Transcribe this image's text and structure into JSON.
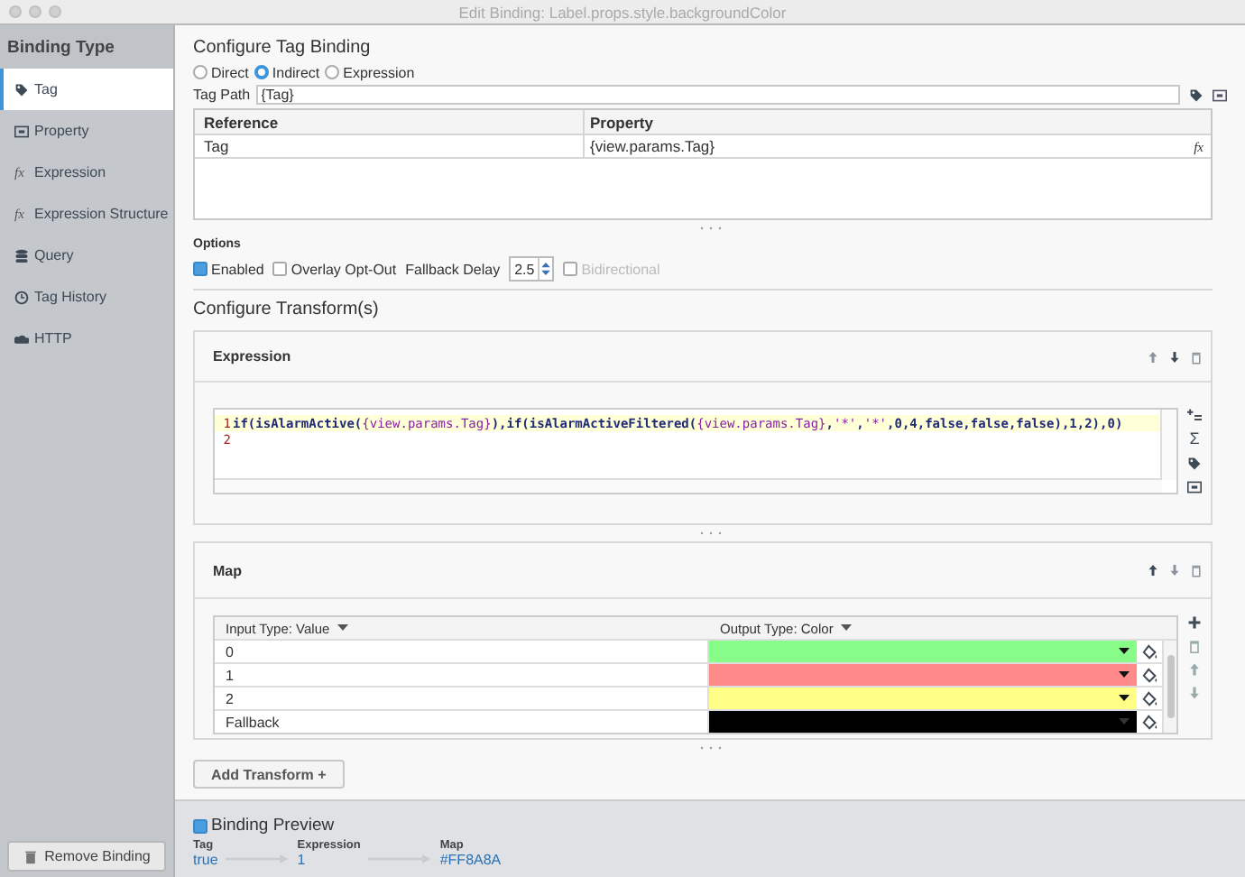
{
  "window": {
    "title": "Edit Binding: Label.props.style.backgroundColor"
  },
  "sidebar": {
    "title": "Binding Type",
    "items": [
      {
        "label": "Tag",
        "selected": true
      },
      {
        "label": "Property",
        "selected": false
      },
      {
        "label": "Expression",
        "selected": false,
        "glyph": "fx"
      },
      {
        "label": "Expression Structure",
        "selected": false,
        "glyph": "fx"
      },
      {
        "label": "Query",
        "selected": false
      },
      {
        "label": "Tag History",
        "selected": false
      },
      {
        "label": "HTTP",
        "selected": false
      }
    ],
    "remove_button": "Remove Binding"
  },
  "tag_binding": {
    "title": "Configure Tag Binding",
    "modes": [
      {
        "label": "Direct",
        "selected": false
      },
      {
        "label": "Indirect",
        "selected": true
      },
      {
        "label": "Expression",
        "selected": false
      }
    ],
    "tag_path": {
      "label": "Tag Path",
      "value": "{Tag}"
    },
    "references": {
      "columns": [
        "Reference",
        "Property"
      ],
      "rows": [
        {
          "reference": "Tag",
          "property": "{view.params.Tag}",
          "button": "fx"
        }
      ]
    },
    "options": {
      "title": "Options",
      "enabled": {
        "label": "Enabled",
        "checked": true
      },
      "overlay_opt_out": {
        "label": "Overlay Opt-Out",
        "checked": false
      },
      "fallback_delay": {
        "label": "Fallback Delay",
        "value": "2.5"
      },
      "bidirectional": {
        "label": "Bidirectional",
        "checked": false,
        "disabled": true
      }
    }
  },
  "transforms": {
    "title": "Configure Transform(s)",
    "expression": {
      "title": "Expression",
      "sum_tool": "Σ",
      "lines": [
        {
          "number": "1",
          "tokens": [
            {
              "text": "if(isAlarmActive(",
              "kind": "code"
            },
            {
              "text": "{view.params.Tag}",
              "kind": "ref"
            },
            {
              "text": "),if(isAlarmActiveFiltered(",
              "kind": "code"
            },
            {
              "text": "{view.params.Tag}",
              "kind": "ref"
            },
            {
              "text": ",",
              "kind": "code"
            },
            {
              "text": "'*'",
              "kind": "ref"
            },
            {
              "text": ",",
              "kind": "code"
            },
            {
              "text": "'*'",
              "kind": "ref"
            },
            {
              "text": ",0,4,false,false,false),1,2),0)",
              "kind": "code"
            }
          ]
        },
        {
          "number": "2"
        }
      ]
    },
    "map": {
      "title": "Map",
      "input_header": "Input Type: Value",
      "output_header": "Output Type: Color",
      "rows": [
        {
          "input": "0",
          "color": "#88fc88"
        },
        {
          "input": "1",
          "color": "#ff8a8a"
        },
        {
          "input": "2",
          "color": "#ffff88"
        },
        {
          "input": "Fallback",
          "color": "#000000"
        }
      ]
    },
    "add_button": "Add Transform +"
  },
  "preview": {
    "enabled": true,
    "label": "Binding Preview",
    "steps": [
      {
        "label": "Tag",
        "value": "true"
      },
      {
        "label": "Expression",
        "value": "1"
      },
      {
        "label": "Map",
        "value": "#FF8A8A"
      }
    ]
  }
}
